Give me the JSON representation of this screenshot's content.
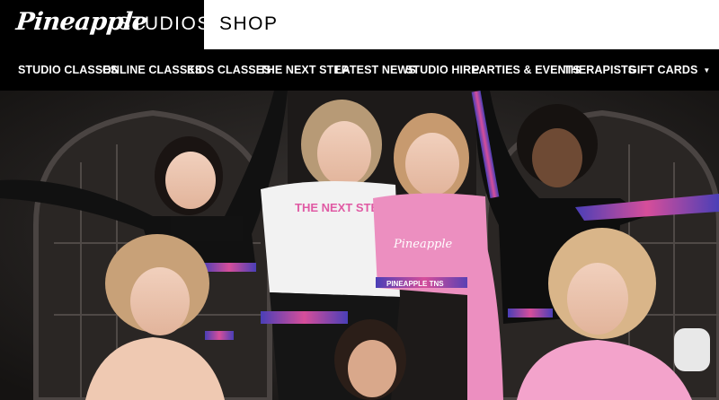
{
  "brand": {
    "script": "Pineapple",
    "studios": "STUDIOS"
  },
  "header": {
    "shop_label": "SHOP"
  },
  "nav": {
    "items": [
      {
        "label": "STUDIO CLASSES"
      },
      {
        "label": "ONLINE CLASSES"
      },
      {
        "label": "KIDS CLASSES"
      },
      {
        "label": "THE NEXT STEP"
      },
      {
        "label": "LATEST NEWS"
      },
      {
        "label": "STUDIO HIRE"
      },
      {
        "label": "PARTIES & EVENTS"
      },
      {
        "label": "THERAPISTS"
      },
      {
        "label": "GIFT CARDS",
        "has_dropdown": true
      }
    ]
  },
  "hero": {
    "shirt_1": "THE NEXT STEP",
    "tape_1": "PINEAPPLE TNS",
    "shirt_2": "Pineapple"
  },
  "colors": {
    "background": "#000000",
    "shop_bg": "#ffffff",
    "tape_pink": "#d64e9a",
    "tape_blue": "#4a3fb7"
  }
}
